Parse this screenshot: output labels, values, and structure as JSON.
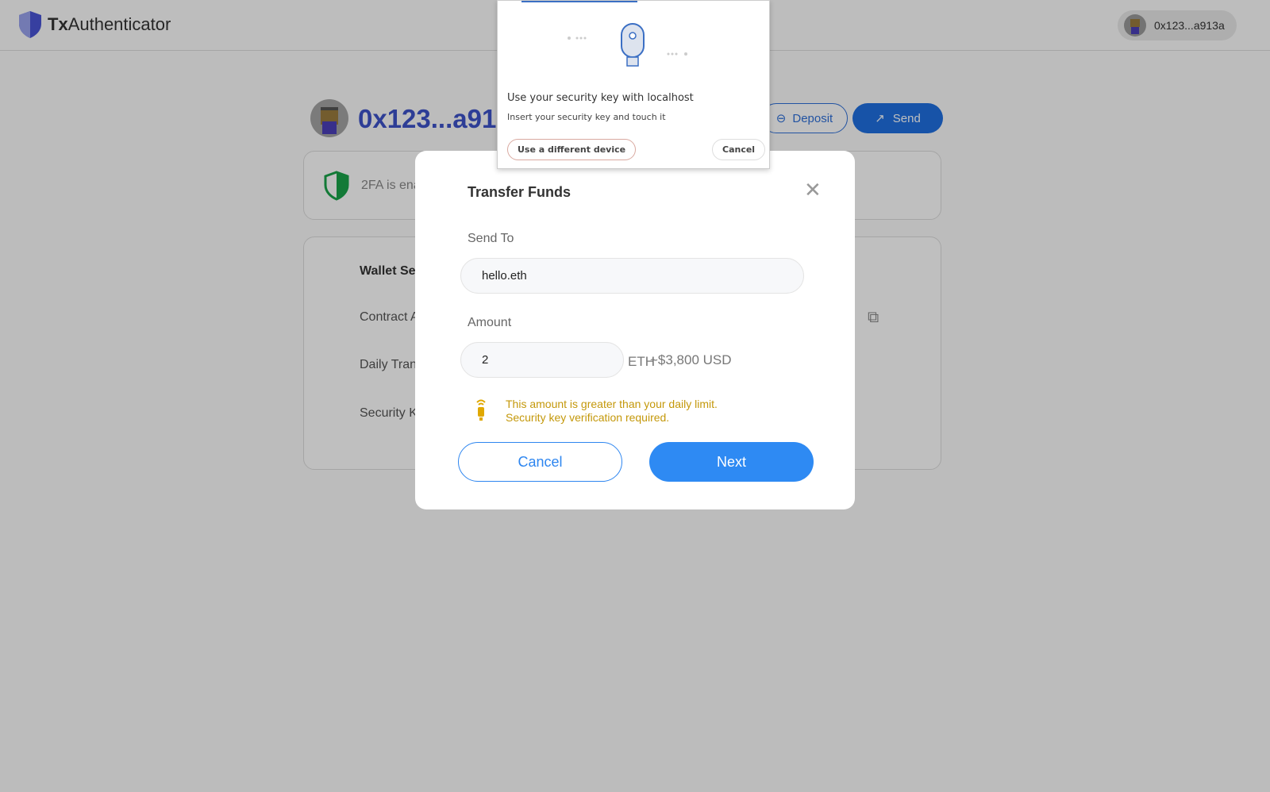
{
  "header": {
    "brand_bold": "Tx",
    "brand_rest": "Authenticator",
    "account": "0x123...a913a"
  },
  "wallet": {
    "address": "0x123...a91",
    "deposit": "Deposit",
    "send": "Send",
    "twofa": "2FA is ena",
    "settings_title": "Wallet Set",
    "rows": [
      "Contract A",
      "Daily Tran",
      "Security K"
    ]
  },
  "modal": {
    "title": "Transfer Funds",
    "send_to_label": "Send To",
    "send_to_value": "hello.eth",
    "amount_label": "Amount",
    "amount_value": "2",
    "unit": "ETH",
    "usd": "~$3,800 USD",
    "warning_1": "This amount is greater than your daily limit.",
    "warning_2": "Security key verification required.",
    "cancel": "Cancel",
    "next": "Next"
  },
  "security_key": {
    "title": "Use your security key with localhost",
    "subtitle": "Insert your security key and touch it",
    "different_device": "Use a different device",
    "cancel": "Cancel"
  },
  "colors": {
    "primary": "#2e8af3",
    "warning": "#c4980a",
    "address": "#3d52c9",
    "shield": "#1aa34a"
  }
}
